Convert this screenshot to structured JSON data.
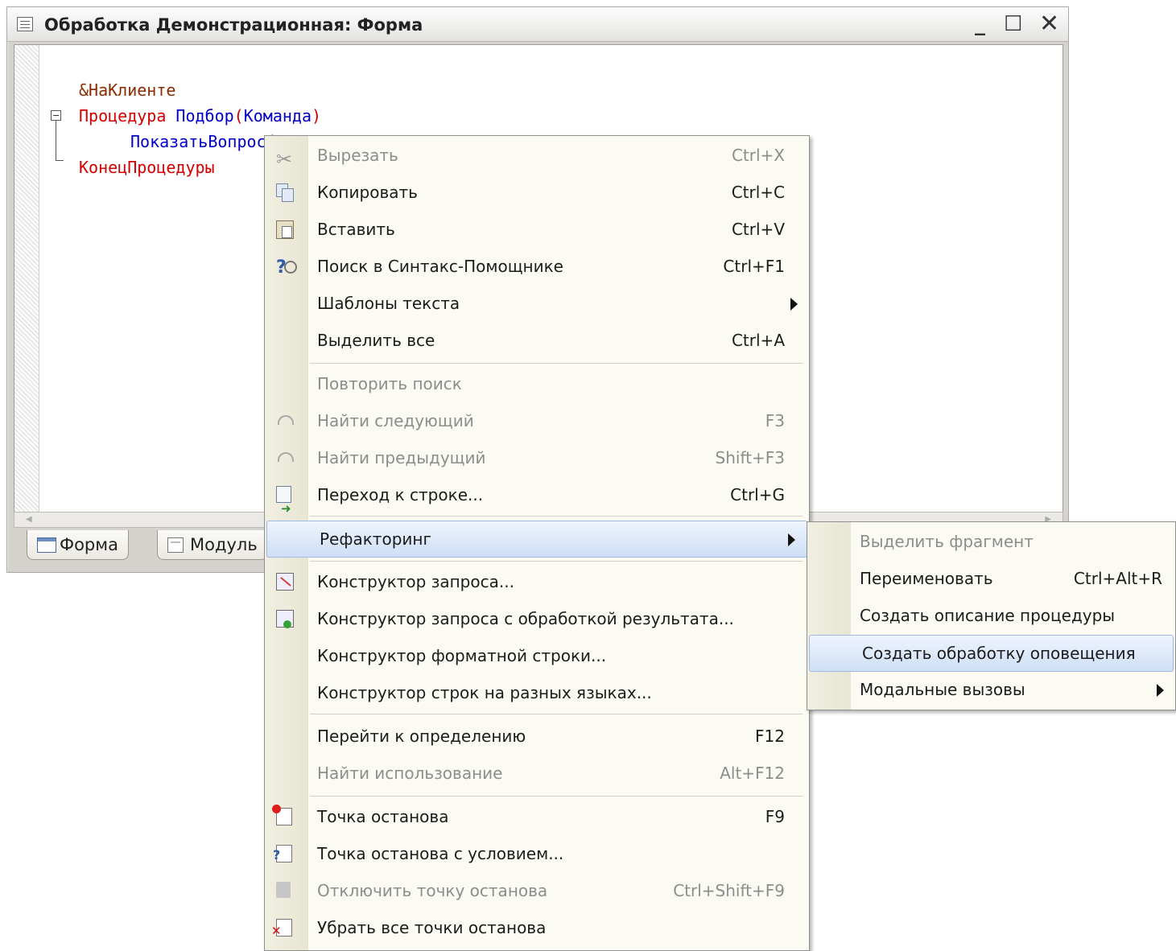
{
  "window": {
    "title": "Обработка Демонстрационная: Форма",
    "controls": {
      "minimize": "_",
      "maximize": "☐",
      "close": "✕"
    }
  },
  "code": {
    "line1": "&НаКлиенте",
    "line2_kw": "Процедура",
    "line2_name": "Подбор",
    "line2_paren_open": "(",
    "line2_param": "Команда",
    "line2_paren_close": ")",
    "line3": "ПоказатьВопрос(",
    "line4": "КонецПроцедуры"
  },
  "tabs": [
    {
      "label": "Форма",
      "icon": "form-icon"
    },
    {
      "label": "Модуль",
      "icon": "module-icon"
    }
  ],
  "context_menu": {
    "items": [
      {
        "label": "Вырезать",
        "shortcut": "Ctrl+X",
        "icon": "cut-icon",
        "enabled": false
      },
      {
        "label": "Копировать",
        "shortcut": "Ctrl+C",
        "icon": "copy-icon",
        "enabled": true
      },
      {
        "label": "Вставить",
        "shortcut": "Ctrl+V",
        "icon": "paste-icon",
        "enabled": true
      },
      {
        "label": "Поиск в Синтакс-Помощнике",
        "shortcut": "Ctrl+F1",
        "icon": "syntax-help-icon",
        "enabled": true
      },
      {
        "label": "Шаблоны текста",
        "shortcut": "",
        "icon": "",
        "enabled": true,
        "submenu": true
      },
      {
        "label": "Выделить все",
        "shortcut": "Ctrl+A",
        "icon": "",
        "enabled": true
      },
      {
        "label": "Повторить поиск",
        "shortcut": "",
        "icon": "",
        "enabled": false
      },
      {
        "label": "Найти следующий",
        "shortcut": "F3",
        "icon": "find-next-icon",
        "enabled": false
      },
      {
        "label": "Найти предыдущий",
        "shortcut": "Shift+F3",
        "icon": "find-prev-icon",
        "enabled": false
      },
      {
        "label": "Переход к строке...",
        "shortcut": "Ctrl+G",
        "icon": "goto-line-icon",
        "enabled": true
      },
      {
        "label": "Рефакторинг",
        "shortcut": "",
        "icon": "",
        "enabled": true,
        "submenu": true,
        "highlighted": true
      },
      {
        "label": "Конструктор запроса...",
        "shortcut": "",
        "icon": "query-builder-icon",
        "enabled": true
      },
      {
        "label": "Конструктор запроса с обработкой результата...",
        "shortcut": "",
        "icon": "query-builder-result-icon",
        "enabled": true
      },
      {
        "label": "Конструктор форматной строки...",
        "shortcut": "",
        "icon": "",
        "enabled": true
      },
      {
        "label": "Конструктор строк на разных языках...",
        "shortcut": "",
        "icon": "",
        "enabled": true
      },
      {
        "label": "Перейти к определению",
        "shortcut": "F12",
        "icon": "",
        "enabled": true
      },
      {
        "label": "Найти использование",
        "shortcut": "Alt+F12",
        "icon": "",
        "enabled": false
      },
      {
        "label": "Точка останова",
        "shortcut": "F9",
        "icon": "breakpoint-icon",
        "enabled": true
      },
      {
        "label": "Точка останова с условием...",
        "shortcut": "",
        "icon": "conditional-breakpoint-icon",
        "enabled": true
      },
      {
        "label": "Отключить точку останова",
        "shortcut": "Ctrl+Shift+F9",
        "icon": "disable-breakpoint-icon",
        "enabled": false
      },
      {
        "label": "Убрать все точки останова",
        "shortcut": "",
        "icon": "remove-breakpoints-icon",
        "enabled": true
      }
    ]
  },
  "refactor_submenu": {
    "items": [
      {
        "label": "Выделить фрагмент",
        "shortcut": "",
        "enabled": false
      },
      {
        "label": "Переименовать",
        "shortcut": "Ctrl+Alt+R",
        "enabled": true
      },
      {
        "label": "Создать описание процедуры",
        "shortcut": "",
        "enabled": true
      },
      {
        "label": "Создать обработку оповещения",
        "shortcut": "",
        "enabled": true,
        "highlighted": true
      },
      {
        "label": "Модальные вызовы",
        "shortcut": "",
        "enabled": true,
        "submenu": true
      }
    ]
  }
}
